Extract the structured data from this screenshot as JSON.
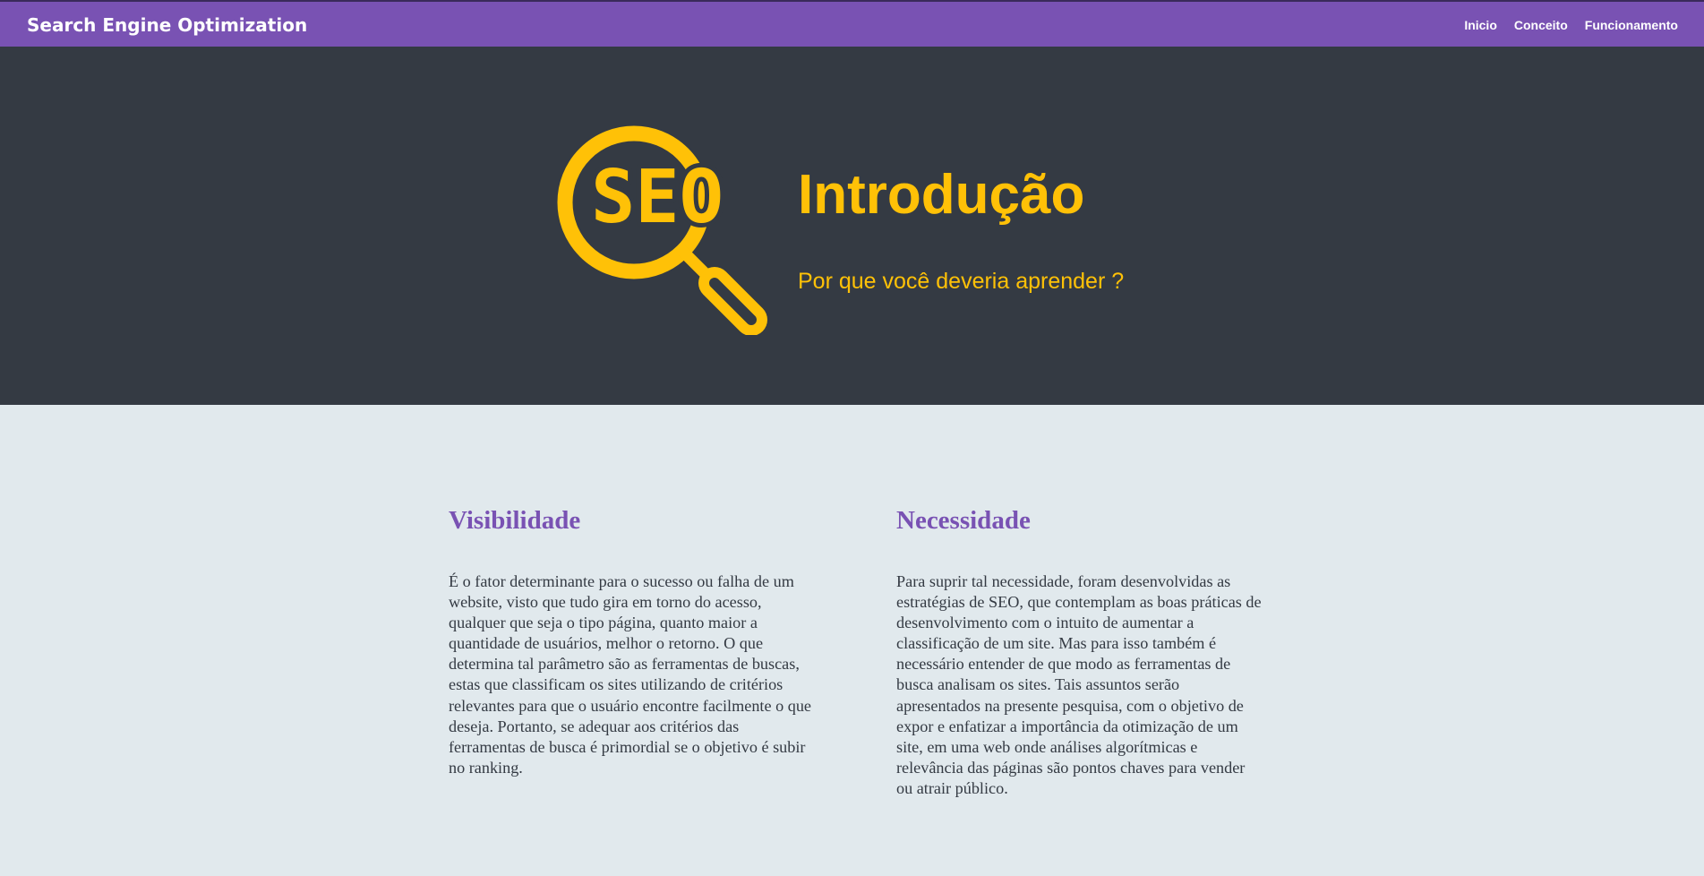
{
  "navbar": {
    "brand": "Search Engine Optimization",
    "links": [
      {
        "label": "Inicio"
      },
      {
        "label": "Conceito"
      },
      {
        "label": "Funcionamento"
      }
    ]
  },
  "hero": {
    "logo_icon": "seo-magnifier-icon",
    "logo_text": "SEO",
    "title": "Introdução",
    "subtitle": "Por que você deveria aprender ?"
  },
  "sections": [
    {
      "heading": "Visibilidade",
      "body": "É o fator determinante para o sucesso ou falha de um website, visto que tudo gira em torno do acesso, qualquer que seja o tipo página, quanto maior a quantidade de usuários, melhor o retorno. O que determina tal parâmetro são as ferramentas de buscas, estas que classificam os sites utilizando de critérios relevantes para que o usuário encontre facilmente o que deseja. Portanto, se adequar aos critérios das ferramentas de busca é primordial se o objetivo é subir no ranking."
    },
    {
      "heading": "Necessidade",
      "body": "Para suprir tal necessidade, foram desenvolvidas as estratégias de SEO, que contemplam as boas práticas de desenvolvimento com o intuito de aumentar a classificação de um site. Mas para isso também é necessário entender de que modo as ferramentas de busca analisam os sites. Tais assuntos serão apresentados na presente pesquisa, com o objetivo de expor e enfatizar a importância da otimização de um site, em uma web onde análises algorítmicas e relevância das páginas são pontos chaves para vender ou atrair público."
    }
  ],
  "colors": {
    "navbar_bg": "#7952b3",
    "hero_bg": "#343a43",
    "accent_yellow": "#ffc107",
    "heading_purple": "#7952b3",
    "page_bg": "#e1e9ed",
    "body_text": "#343a43"
  }
}
